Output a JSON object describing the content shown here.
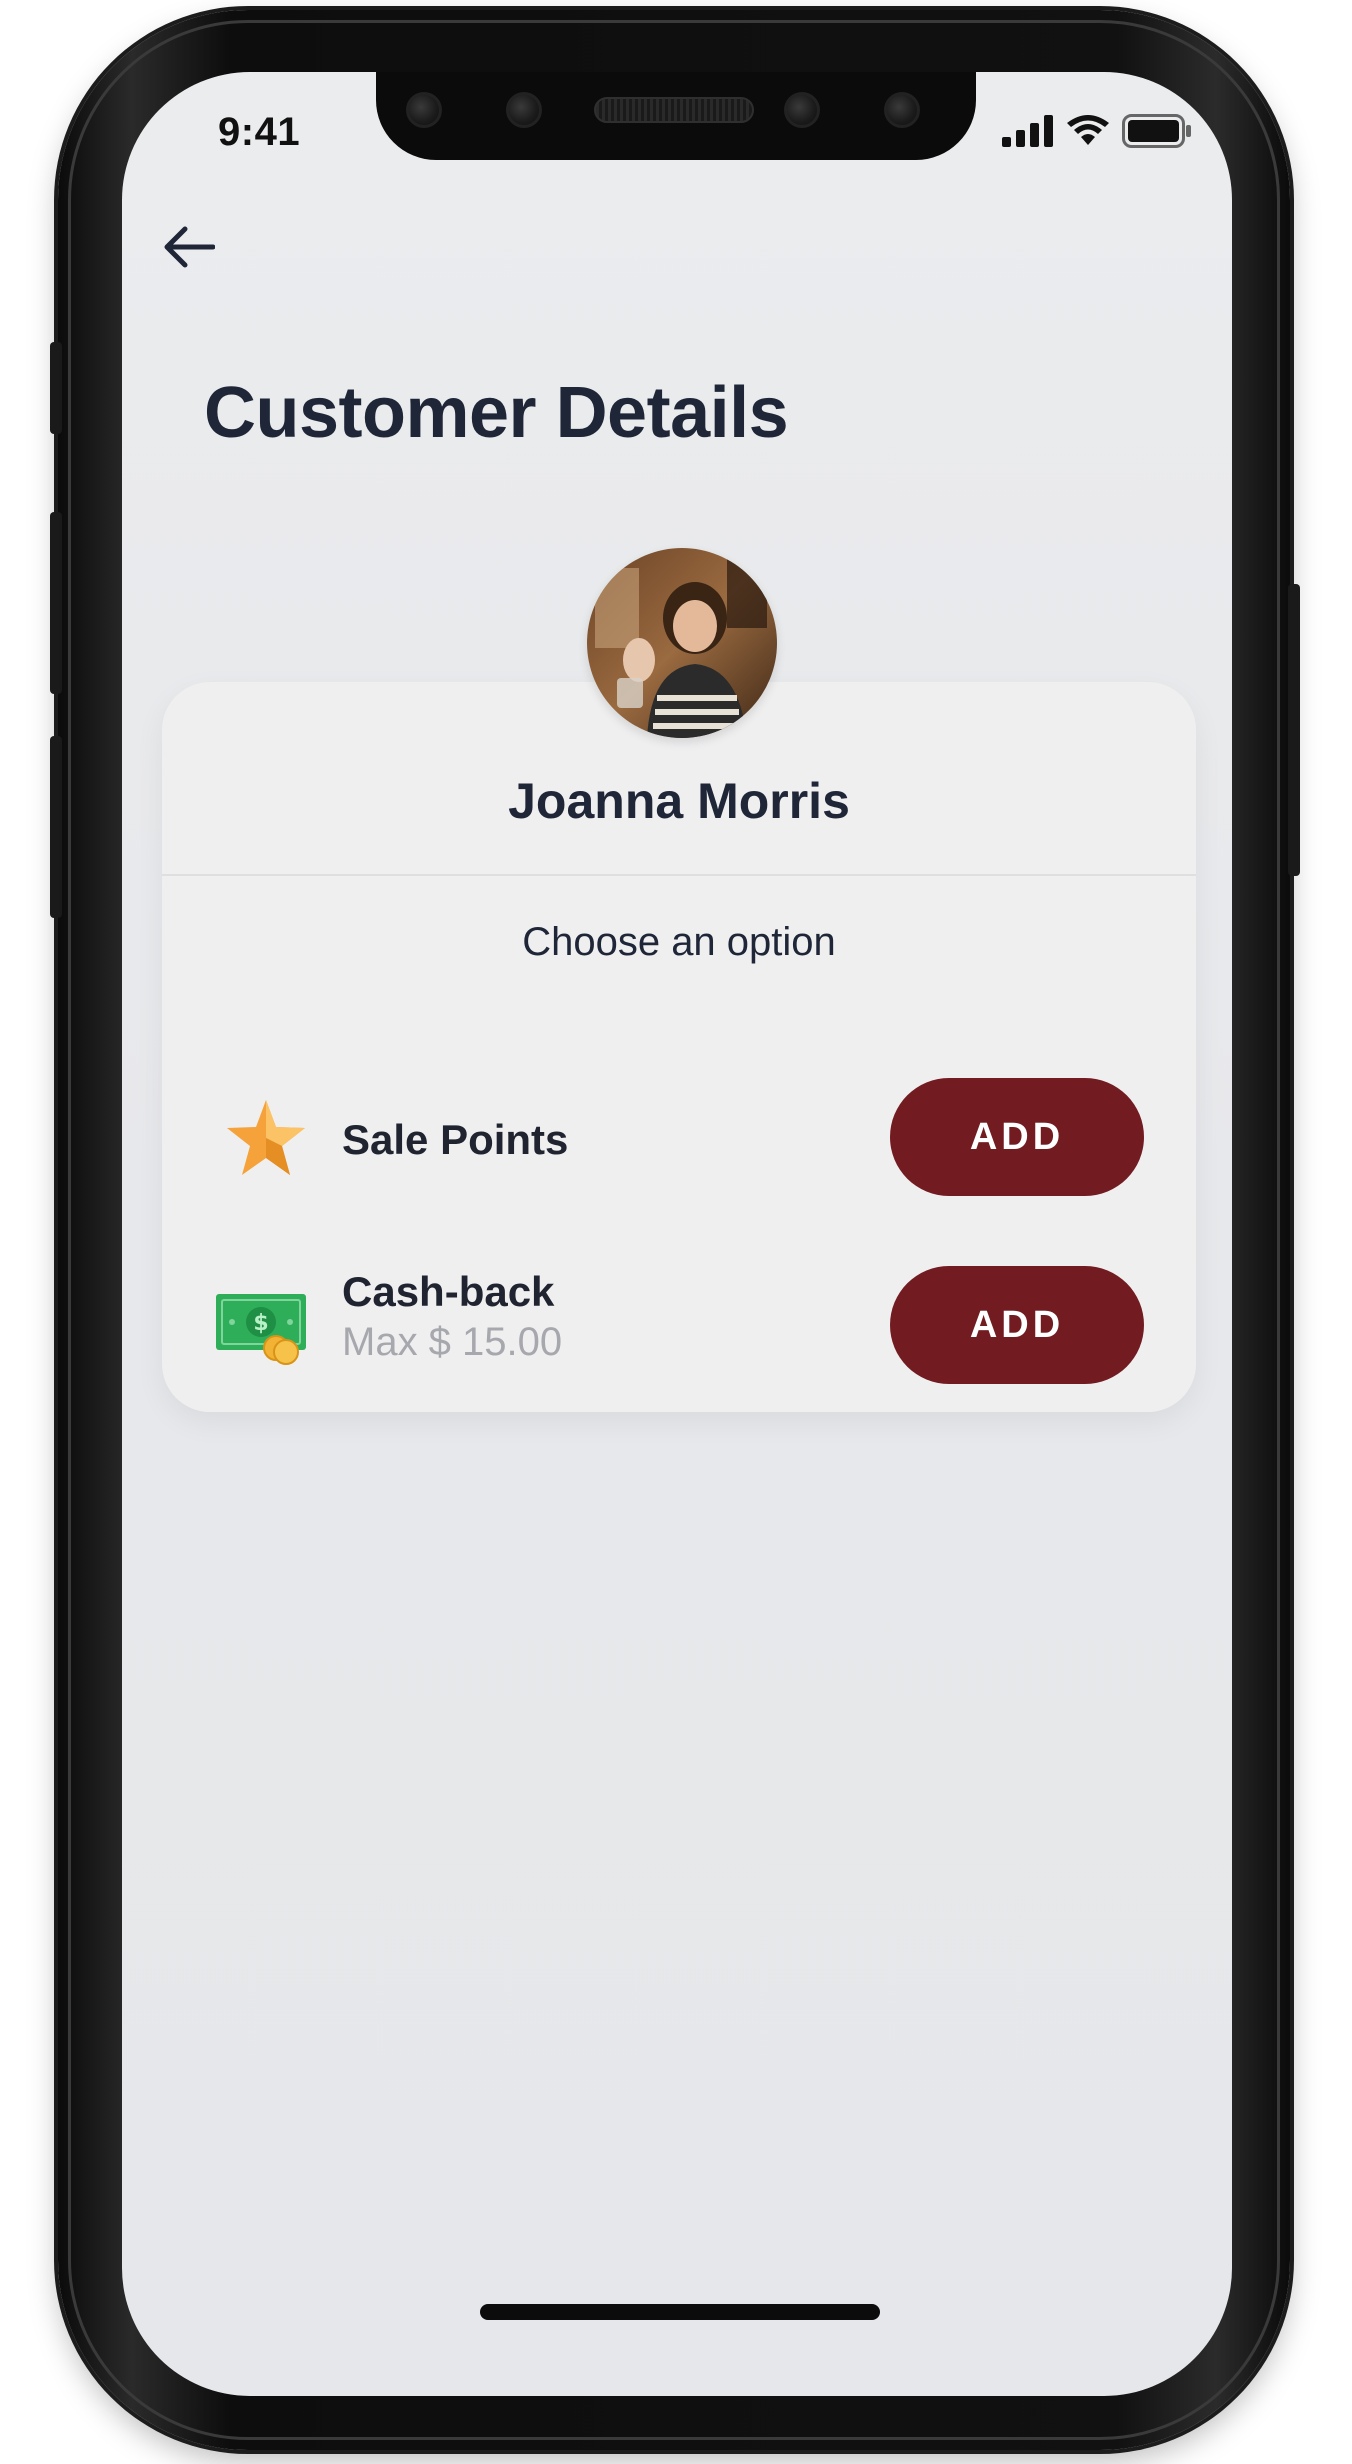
{
  "status_bar": {
    "time": "9:41",
    "icons": [
      "cellular-signal-icon",
      "wifi-icon",
      "battery-icon"
    ]
  },
  "header": {
    "back_icon": "arrow-left-icon",
    "title": "Customer Details"
  },
  "customer": {
    "name": "Joanna Morris",
    "avatar": "customer-photo"
  },
  "options": {
    "prompt": "Choose an option",
    "items": [
      {
        "icon": "star-icon",
        "label": "Sale Points",
        "sublabel": "",
        "button_label": "ADD"
      },
      {
        "icon": "cash-icon",
        "label": "Cash-back",
        "sublabel": "Max $ 15.00",
        "button_label": "ADD"
      }
    ]
  },
  "colors": {
    "accent": "#721c21",
    "title": "#1f2638",
    "background": "#e9eaec",
    "card": "#efeff0",
    "star": "#f5a23a",
    "cash": "#2fae5a"
  }
}
